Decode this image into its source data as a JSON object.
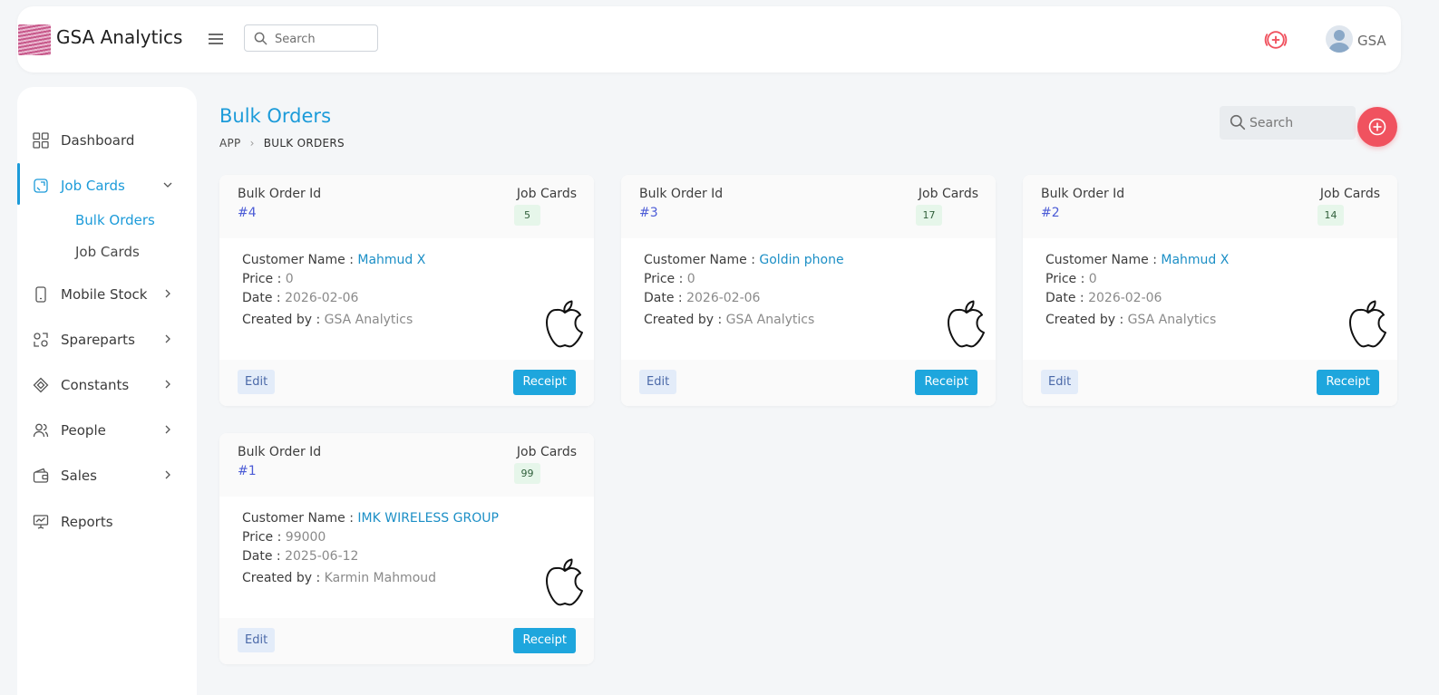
{
  "app": {
    "brand": "GSA Analytics",
    "search_placeholder": "Search",
    "user_label": "GSA"
  },
  "sidebar": {
    "items": [
      {
        "label": "Dashboard",
        "icon": "grid-icon"
      },
      {
        "label": "Job Cards",
        "icon": "job-card-icon",
        "active": true
      },
      {
        "label": "Mobile Stock",
        "icon": "mobile-icon"
      },
      {
        "label": "Spareparts",
        "icon": "spareparts-icon"
      },
      {
        "label": "Constants",
        "icon": "diamond-icon"
      },
      {
        "label": "People",
        "icon": "people-icon"
      },
      {
        "label": "Sales",
        "icon": "wallet-icon"
      },
      {
        "label": "Reports",
        "icon": "presentation-chart-icon"
      }
    ],
    "sub_items": [
      {
        "label": "Bulk Orders",
        "active": true
      },
      {
        "label": "Job Cards",
        "active": false
      }
    ]
  },
  "page": {
    "title": "Bulk Orders",
    "breadcrumb": [
      "APP",
      "BULK ORDERS"
    ],
    "search_placeholder": "Search"
  },
  "card_labels": {
    "bulk_order_id": "Bulk Order Id",
    "job_cards": "Job Cards",
    "customer_name": "Customer Name :",
    "price": "Price :",
    "date": "Date :",
    "created_by": "Created by :",
    "edit": "Edit",
    "receipt": "Receipt"
  },
  "cards": [
    {
      "id": "#4",
      "job_cards": "5",
      "customer": "Mahmud X",
      "price": "0",
      "date": "2026-02-06",
      "created_by": "GSA Analytics",
      "brand_icon": "apple-icon"
    },
    {
      "id": "#3",
      "job_cards": "17",
      "customer": "Goldin phone",
      "price": "0",
      "date": "2026-02-06",
      "created_by": "GSA Analytics",
      "brand_icon": "apple-icon"
    },
    {
      "id": "#2",
      "job_cards": "14",
      "customer": "Mahmud X",
      "price": "0",
      "date": "2026-02-06",
      "created_by": "GSA Analytics",
      "brand_icon": "apple-icon"
    },
    {
      "id": "#1",
      "job_cards": "99",
      "customer": "IMK WIRELESS GROUP",
      "price": "99000",
      "date": "2025-06-12",
      "created_by": "Karmin Mahmoud",
      "brand_icon": "apple-icon"
    }
  ],
  "colors": {
    "accent": "#1c9bd9",
    "danger": "#f0525f",
    "receipt": "#1ea6dd",
    "id_link": "#4b5bd6"
  }
}
